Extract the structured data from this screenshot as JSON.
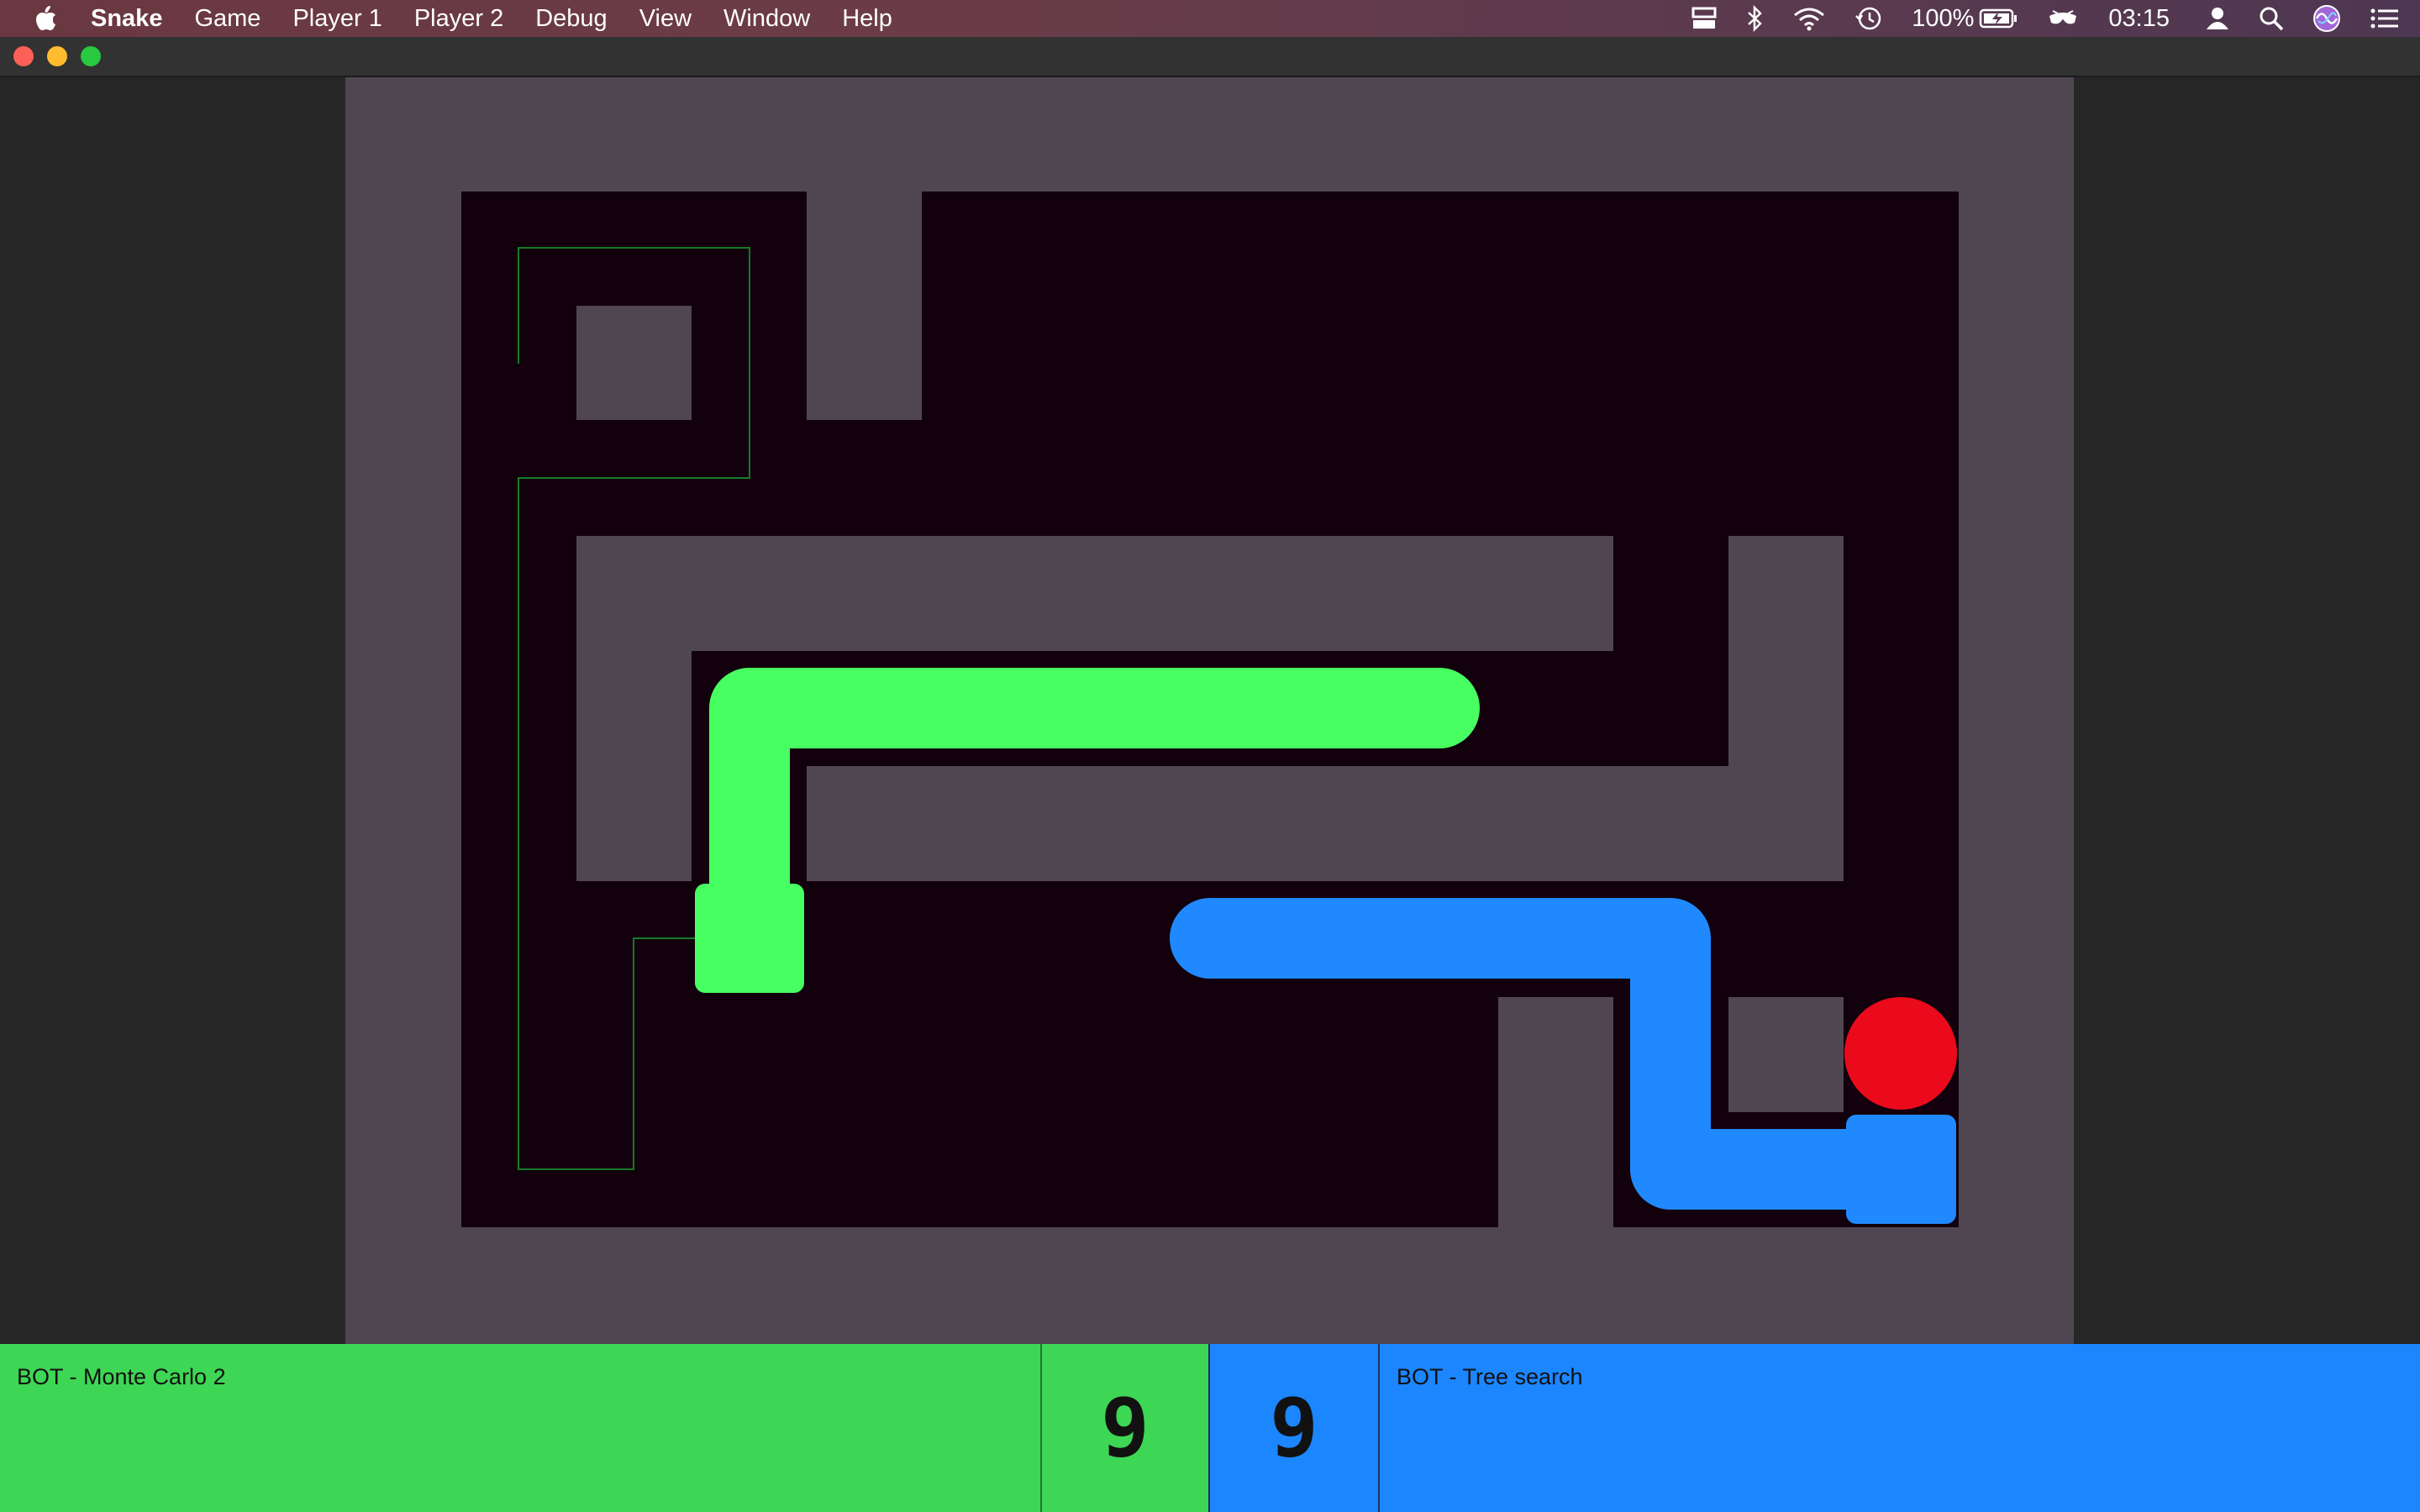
{
  "menubar": {
    "app_name": "Snake",
    "menus": [
      "Game",
      "Player 1",
      "Player 2",
      "Debug",
      "View",
      "Window",
      "Help"
    ],
    "battery_percent": "100%",
    "clock": "03:15",
    "status_icons": [
      "display-icon",
      "bluetooth-icon",
      "wifi-icon",
      "time-machine-icon",
      "battery-icon",
      "glasses-icon",
      "user-icon",
      "spotlight-search-icon",
      "siri-icon",
      "notification-center-icon"
    ]
  },
  "window": {
    "traffic_lights": [
      "close",
      "minimize",
      "maximize"
    ]
  },
  "players": {
    "player1": {
      "name": "BOT - Monte Carlo 2",
      "score": "9",
      "color": "#3ed655",
      "snake_color": "#47ff60"
    },
    "player2": {
      "name": "BOT - Tree search",
      "score": "9",
      "color": "#1c86ff",
      "snake_color": "#2089ff"
    }
  },
  "colors": {
    "background": "#262626",
    "wall": "#504652",
    "floor": "#12000c",
    "food": "#eb0a1c",
    "path_trace": "#157a2a"
  }
}
